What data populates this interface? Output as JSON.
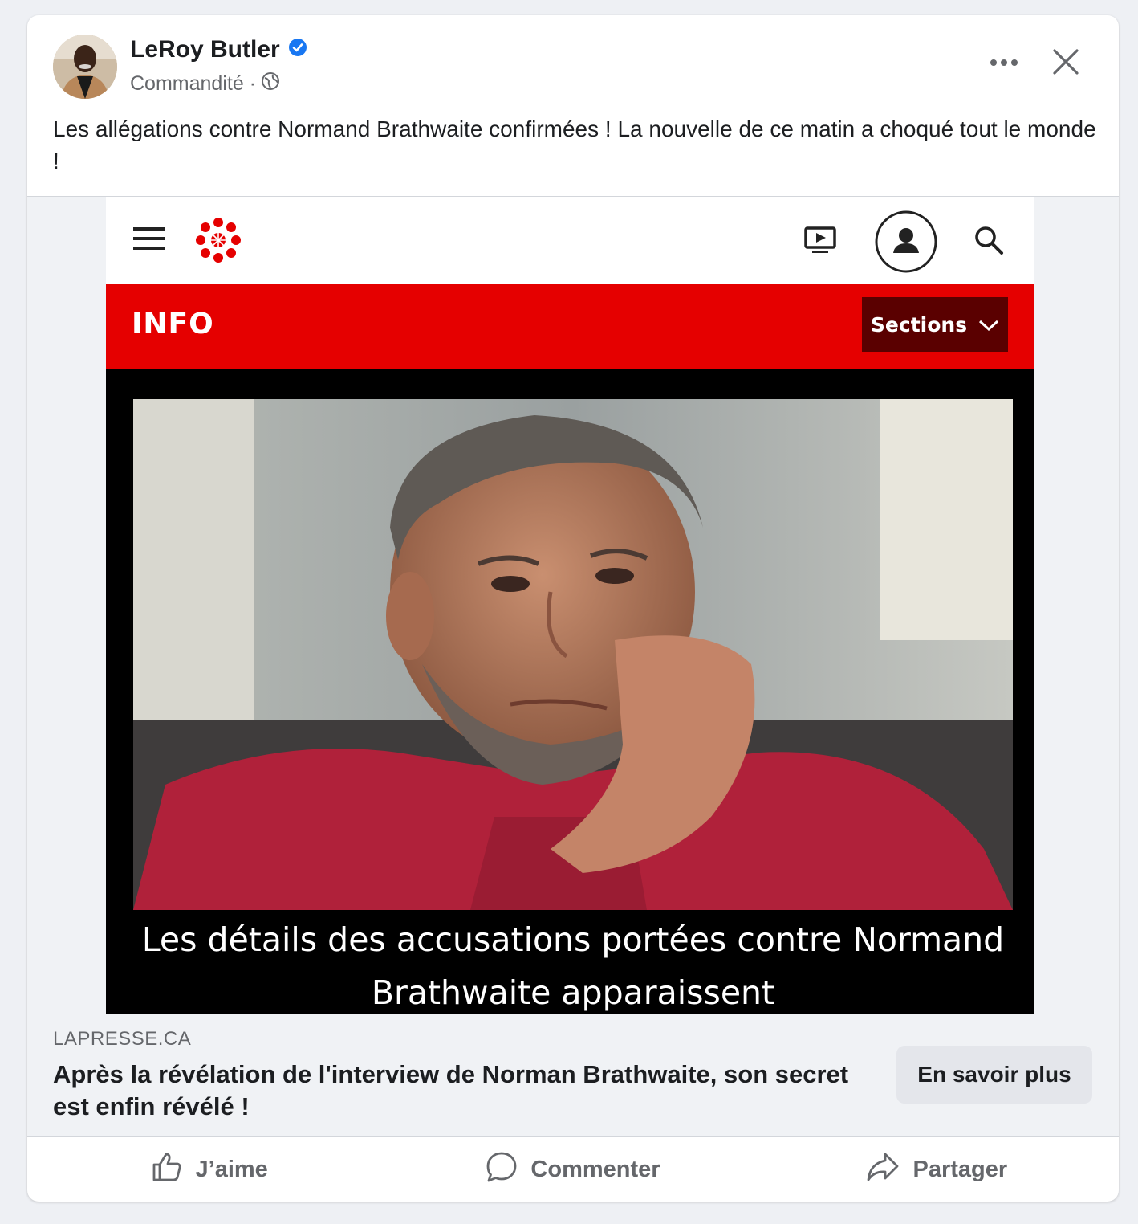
{
  "post": {
    "author": "LeRoy Butler",
    "verified": true,
    "meta_label": "Commandité ·",
    "text": "Les allégations contre Normand Brathwaite confirmées ! La nouvelle de ce matin a choqué tout le monde !"
  },
  "embedded_screenshot": {
    "section_title": "INFO",
    "sections_button": "Sections",
    "caption_line1": "Les détails des accusations portées contre Normand",
    "caption_line2": "Brathwaite apparaissent",
    "accent_color": "#e50000"
  },
  "link_preview": {
    "domain": "LAPRESSE.CA",
    "headline": "Après la révélation de l'interview de Norman Brathwaite, son secret est enfin révélé !",
    "cta": "En savoir plus"
  },
  "actions": {
    "like": "J’aime",
    "comment": "Commenter",
    "share": "Partager"
  },
  "icons": [
    "globe-icon",
    "verified-badge-icon",
    "more-options-icon",
    "close-icon",
    "hamburger-menu-icon",
    "cbc-gem-logo-icon",
    "video-icon",
    "user-account-icon",
    "search-icon",
    "chevron-down-icon",
    "thumbs-up-icon",
    "comment-bubble-icon",
    "share-arrow-icon"
  ]
}
